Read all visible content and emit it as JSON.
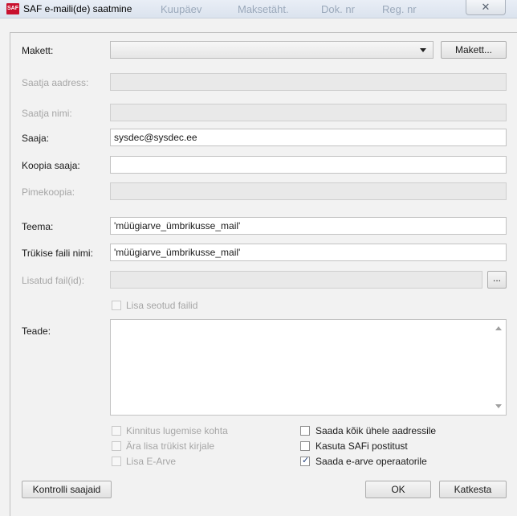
{
  "window": {
    "title": "SAF e-maili(de) saatmine",
    "background_text": [
      "Kuupäev",
      "Maksetäht.",
      "Dok. nr",
      "Reg. nr"
    ],
    "close_symbol": "✕",
    "app_icon_text": "SAF"
  },
  "template": {
    "label": "Makett:",
    "value": "",
    "button_label": "Makett..."
  },
  "fields": {
    "sender_address": {
      "label": "Saatja aadress:",
      "value": ""
    },
    "sender_name": {
      "label": "Saatja nimi:",
      "value": ""
    },
    "recipient": {
      "label": "Saaja:",
      "value": "sysdec@sysdec.ee"
    },
    "cc": {
      "label": "Koopia saaja:",
      "value": ""
    },
    "bcc": {
      "label": "Pimekoopia:",
      "value": ""
    },
    "subject": {
      "label": "Teema:",
      "value": "'müügiarve_ümbrikusse_mail'"
    },
    "print_file_name": {
      "label": "Trükise faili nimi:",
      "value": "'müügiarve_ümbrikusse_mail'"
    },
    "attachments": {
      "label": "Lisatud fail(id):",
      "value": "",
      "browse_label": "..."
    },
    "message": {
      "label": "Teade:",
      "value": ""
    }
  },
  "checkboxes": {
    "add_related_files": {
      "label": "Lisa seotud failid",
      "checked": false,
      "enabled": false
    },
    "read_receipt": {
      "label": "Kinnitus lugemise kohta",
      "checked": false,
      "enabled": false
    },
    "no_print_attachment": {
      "label": "Ära lisa trükist kirjale",
      "checked": false,
      "enabled": false
    },
    "add_einvoice": {
      "label": "Lisa E-Arve",
      "checked": false,
      "enabled": false
    },
    "send_all_one_address": {
      "label": "Saada kõik ühele aadressile",
      "checked": false,
      "enabled": true
    },
    "use_saf_mail": {
      "label": "Kasuta SAFi postitust",
      "checked": false,
      "enabled": true
    },
    "send_einvoice_operators": {
      "label": "Saada e-arve operaatorile",
      "checked": true,
      "enabled": true
    }
  },
  "buttons": {
    "check_recipients": "Kontrolli saajaid",
    "ok": "OK",
    "cancel": "Katkesta"
  },
  "icons": {
    "checkmark": "✓"
  }
}
